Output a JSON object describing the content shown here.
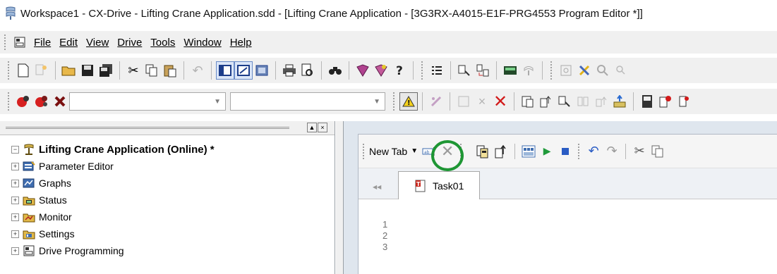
{
  "window": {
    "title": "Workspace1 - CX-Drive - Lifting Crane Application.sdd - [Lifting Crane Application - [3G3RX-A4015-E1F-PRG4553 Program Editor *]]",
    "title_icon": "cx-drive-app-icon"
  },
  "menu": {
    "items": [
      {
        "label": "File",
        "mnemonic_index": 0
      },
      {
        "label": "Edit",
        "mnemonic_index": 0
      },
      {
        "label": "View",
        "mnemonic_index": 0
      },
      {
        "label": "Drive",
        "mnemonic_index": 0
      },
      {
        "label": "Tools",
        "mnemonic_index": 0
      },
      {
        "label": "Window",
        "mnemonic_index": 0
      },
      {
        "label": "Help",
        "mnemonic_index": 0
      }
    ]
  },
  "tree": {
    "root": {
      "label": "Lifting Crane Application (Online) *",
      "expander": "−"
    },
    "children": [
      {
        "label": "Parameter Editor",
        "expander": "+",
        "icon": "parameter-editor-icon"
      },
      {
        "label": "Graphs",
        "expander": "+",
        "icon": "graphs-icon"
      },
      {
        "label": "Status",
        "expander": "+",
        "icon": "status-icon"
      },
      {
        "label": "Monitor",
        "expander": "+",
        "icon": "monitor-icon"
      },
      {
        "label": "Settings",
        "expander": "+",
        "icon": "settings-icon"
      },
      {
        "label": "Drive Programming",
        "expander": "+",
        "icon": "drive-programming-icon"
      }
    ]
  },
  "pane_buttons": {
    "up": "▲",
    "close": "×"
  },
  "editor": {
    "new_tab_label": "New Tab",
    "tab_label": "Task01",
    "line_numbers": [
      "1",
      "2",
      "3"
    ]
  },
  "colors": {
    "highlight": "#1e9634",
    "toolbar_bg": "#f0f0f0",
    "editor_bg": "#dfe6ee"
  }
}
